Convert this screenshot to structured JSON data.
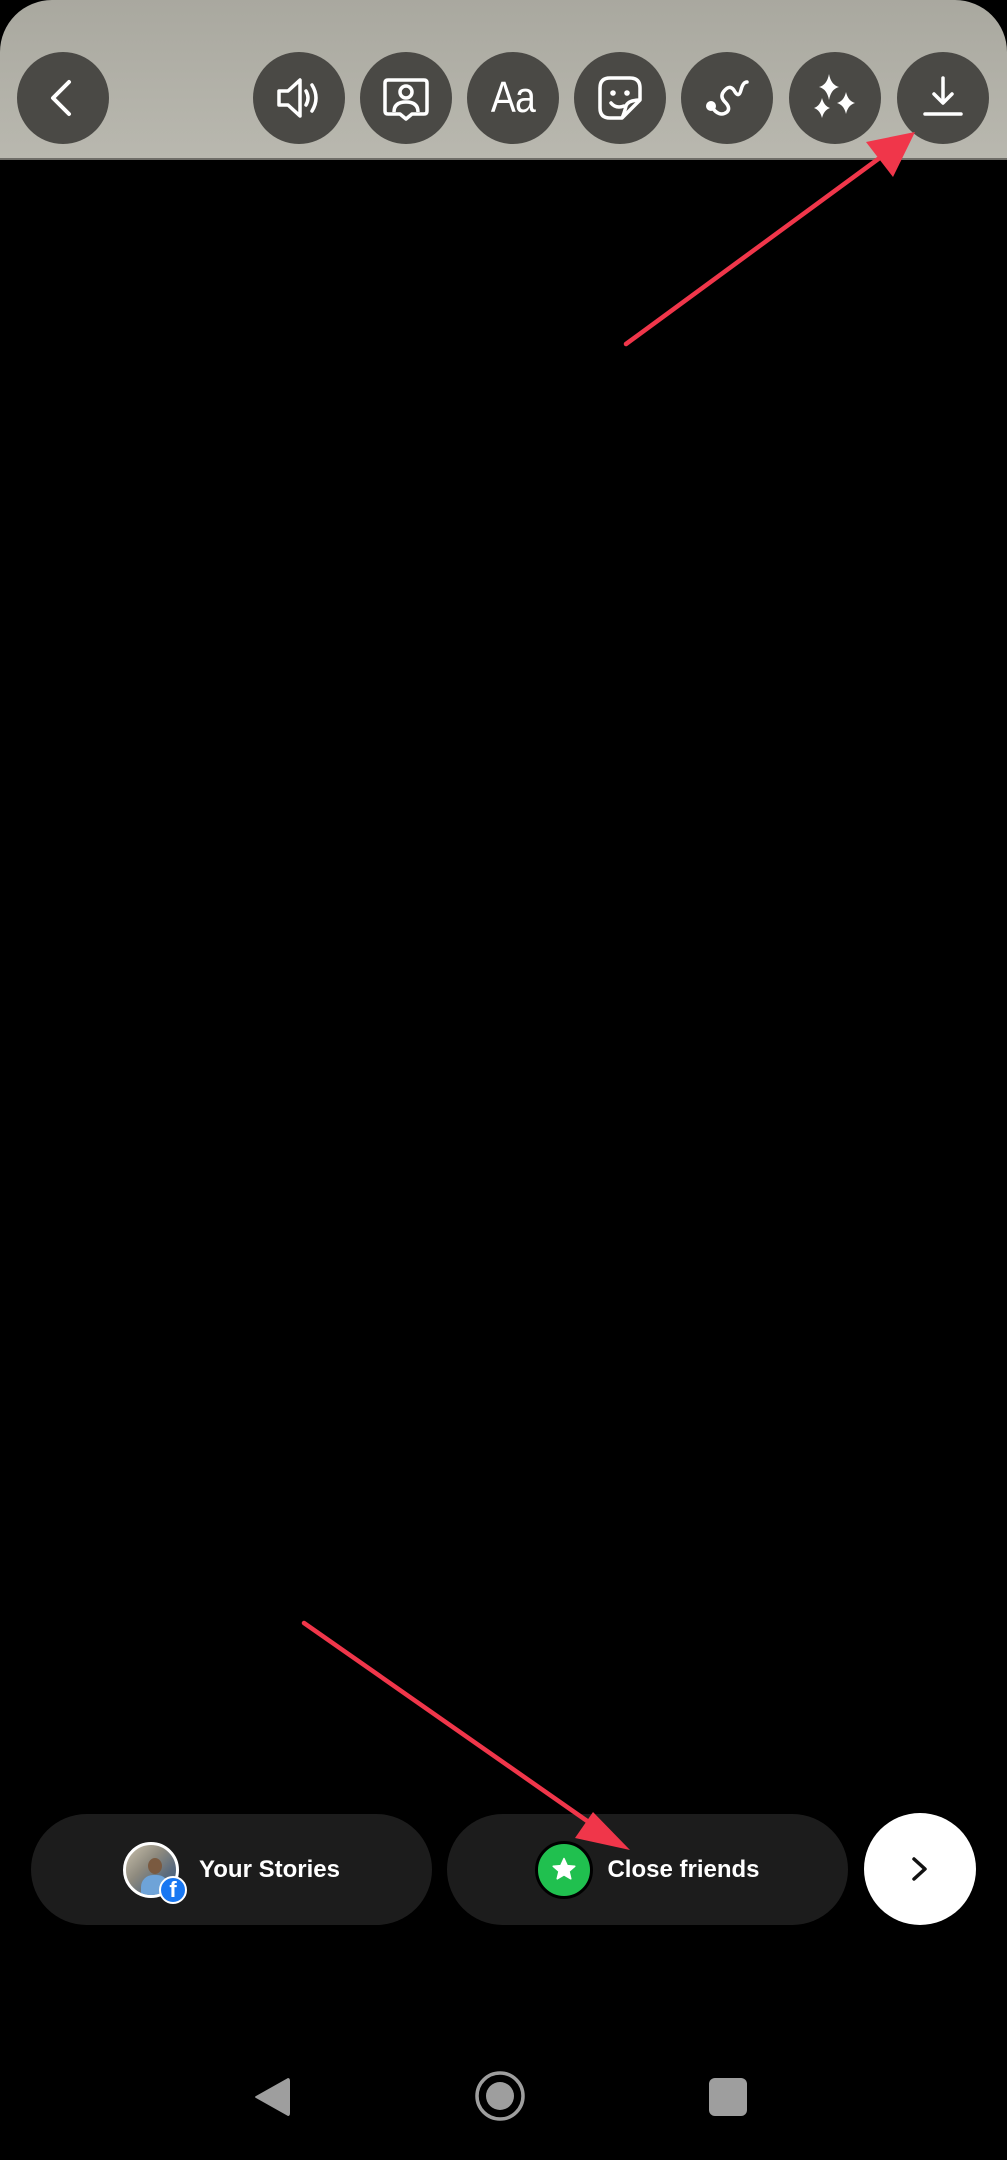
{
  "toolbar": {
    "buttons": [
      {
        "id": "back",
        "icon": "chevron-left-icon",
        "label": "Back"
      },
      {
        "id": "sound",
        "icon": "speaker-icon",
        "label": "Sound"
      },
      {
        "id": "mention",
        "icon": "mention-person-icon",
        "label": "Mention"
      },
      {
        "id": "text",
        "icon": "text-aa-icon",
        "label": "Aa"
      },
      {
        "id": "sticker",
        "icon": "sticker-icon",
        "label": "Stickers"
      },
      {
        "id": "draw",
        "icon": "draw-squiggle-icon",
        "label": "Draw"
      },
      {
        "id": "effects",
        "icon": "sparkles-icon",
        "label": "Effects"
      },
      {
        "id": "download",
        "icon": "download-icon",
        "label": "Download"
      }
    ],
    "text_button_label": "Aa"
  },
  "share": {
    "your_stories_label": "Your Stories",
    "close_friends_label": "Close friends",
    "next_icon": "chevron-right-icon",
    "facebook_badge": "f"
  },
  "colors": {
    "toolbar_bg": "#b0afa6",
    "toolbar_button": "#4a4945",
    "pill_bg": "#1c1c1c",
    "close_friends_green": "#20c04f",
    "facebook_blue": "#1877f2",
    "annotation_arrow": "#f0364a",
    "nav_icon": "#9e9e9e"
  },
  "annotations": [
    {
      "id": "arrow-to-download",
      "points_to": "download-button"
    },
    {
      "id": "arrow-to-close-friends",
      "points_to": "close-friends-button"
    }
  ],
  "navbar": {
    "items": [
      "back",
      "home",
      "recents"
    ]
  }
}
